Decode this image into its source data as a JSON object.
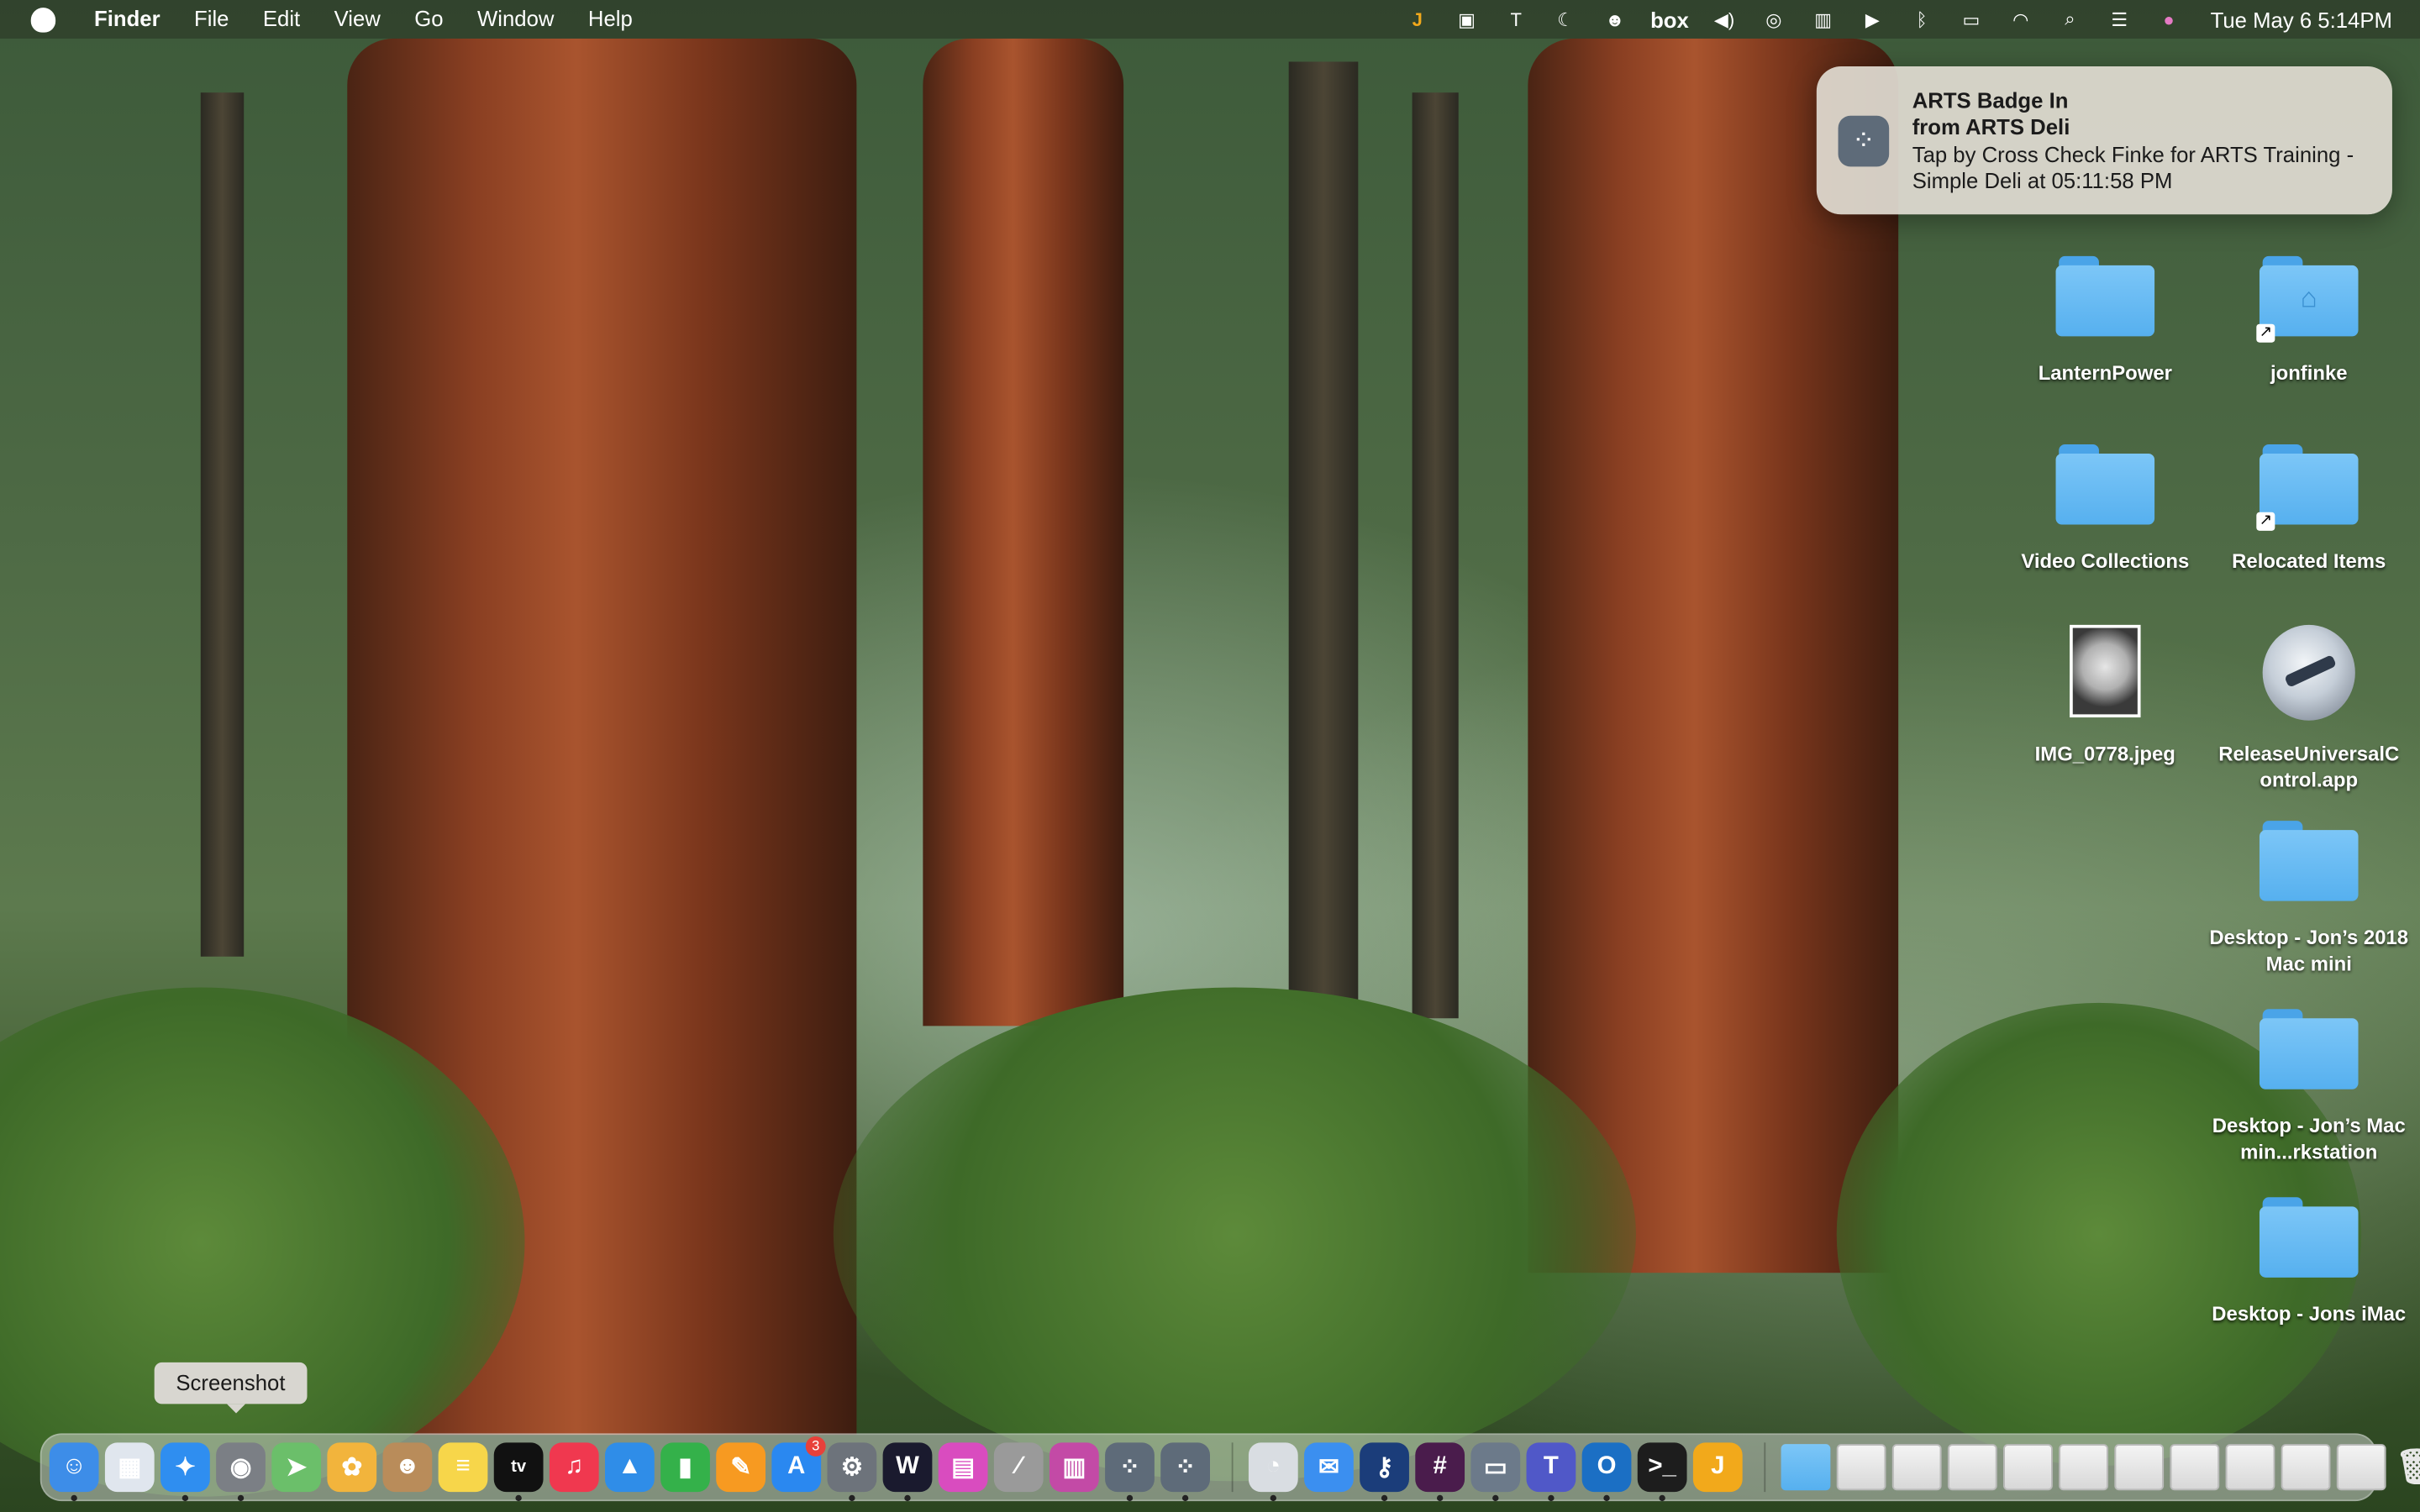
{
  "menubar": {
    "app_name": "Finder",
    "menus": [
      "File",
      "Edit",
      "View",
      "Go",
      "Window",
      "Help"
    ],
    "status_text": "box",
    "clock": "Tue May 6  5:14PM"
  },
  "notification": {
    "title": "ARTS Badge In",
    "subtitle": "from ARTS Deli",
    "body": "Tap by Cross Check Finke for ARTS Training - Simple Deli at 05:11:58 PM"
  },
  "desktop": {
    "items": [
      {
        "label": "LanternPower"
      },
      {
        "label": "jonfinke"
      },
      {
        "label": "Video Collections"
      },
      {
        "label": "Relocated Items"
      },
      {
        "label": "IMG_0778.jpeg"
      },
      {
        "label": "ReleaseUniversalControl.app"
      },
      {
        "label": "Desktop - Jon’s 2018 Mac mini"
      },
      {
        "label": "Desktop - Jon’s Mac min...rkstation"
      },
      {
        "label": "Desktop - Jons iMac"
      }
    ]
  },
  "tooltip": {
    "text": "Screenshot"
  },
  "dock": {
    "apps": [
      {
        "name": "Finder",
        "color": "#3d8de8",
        "glyph": "☺",
        "running": true
      },
      {
        "name": "Launchpad",
        "color": "#e0e6ee",
        "glyph": "▦"
      },
      {
        "name": "Safari",
        "color": "#2f8ef0",
        "glyph": "✦",
        "running": true
      },
      {
        "name": "Screenshot",
        "color": "#7b7f85",
        "glyph": "◉",
        "running": true
      },
      {
        "name": "Maps",
        "color": "#6bbf6a",
        "glyph": "➤"
      },
      {
        "name": "Photos",
        "color": "#f2b43c",
        "glyph": "✿"
      },
      {
        "name": "Contacts",
        "color": "#b98c5a",
        "glyph": "☻"
      },
      {
        "name": "Notes",
        "color": "#f7d64a",
        "glyph": "≡"
      },
      {
        "name": "TV",
        "color": "#111111",
        "glyph": "tv",
        "running": true
      },
      {
        "name": "Music",
        "color": "#f0384f",
        "glyph": "♫"
      },
      {
        "name": "Keynote",
        "color": "#2f8de8",
        "glyph": "▲"
      },
      {
        "name": "Numbers",
        "color": "#34b14a",
        "glyph": "▮"
      },
      {
        "name": "Pages",
        "color": "#f79a21",
        "glyph": "✎"
      },
      {
        "name": "App Store",
        "color": "#2a88f0",
        "glyph": "A",
        "badge": "3"
      },
      {
        "name": "System Settings",
        "color": "#6d737b",
        "glyph": "⚙",
        "running": true
      },
      {
        "name": "Webex",
        "color": "#1a1a2e",
        "glyph": "W",
        "running": true
      },
      {
        "name": "Tempo",
        "color": "#d94cbf",
        "glyph": "▤"
      },
      {
        "name": "Calculator",
        "color": "#9a9a9a",
        "glyph": "∕"
      },
      {
        "name": "Stocks",
        "color": "#c34aa6",
        "glyph": "▥"
      },
      {
        "name": "ARTS Badge",
        "color": "#5e6b79",
        "glyph": "⁘",
        "running": true
      },
      {
        "name": "ARTS Deli",
        "color": "#5e6b79",
        "glyph": "⁘",
        "running": true
      }
    ],
    "apps_right": [
      {
        "name": "Monitor",
        "color": "#d9dde2",
        "glyph": "◔",
        "running": true
      },
      {
        "name": "Mail",
        "color": "#3b8ff0",
        "glyph": "✉"
      },
      {
        "name": "Passwords",
        "color": "#1b3d7a",
        "glyph": "⚷",
        "running": true
      },
      {
        "name": "Slack",
        "color": "#4a1c4c",
        "glyph": "#",
        "running": true
      },
      {
        "name": "Remote Desktop",
        "color": "#6c7a8a",
        "glyph": "▭",
        "running": true
      },
      {
        "name": "Teams",
        "color": "#5058c8",
        "glyph": "T",
        "running": true
      },
      {
        "name": "Outlook",
        "color": "#1b6fc4",
        "glyph": "O",
        "running": true
      },
      {
        "name": "Terminal",
        "color": "#1d1d1d",
        "glyph": ">_",
        "running": true
      },
      {
        "name": "Jamf",
        "color": "#f2a91b",
        "glyph": "J"
      }
    ],
    "stacks": [
      {
        "name": "Folder"
      },
      {
        "name": "Doc 1"
      },
      {
        "name": "Doc 2"
      },
      {
        "name": "Doc 3"
      },
      {
        "name": "Doc 4"
      },
      {
        "name": "Doc 5"
      },
      {
        "name": "Doc 6"
      },
      {
        "name": "Doc 7"
      },
      {
        "name": "Doc 8"
      },
      {
        "name": "Doc 9"
      },
      {
        "name": "Doc 10"
      }
    ],
    "trash": {
      "name": "Trash",
      "glyph": "🗑"
    }
  }
}
